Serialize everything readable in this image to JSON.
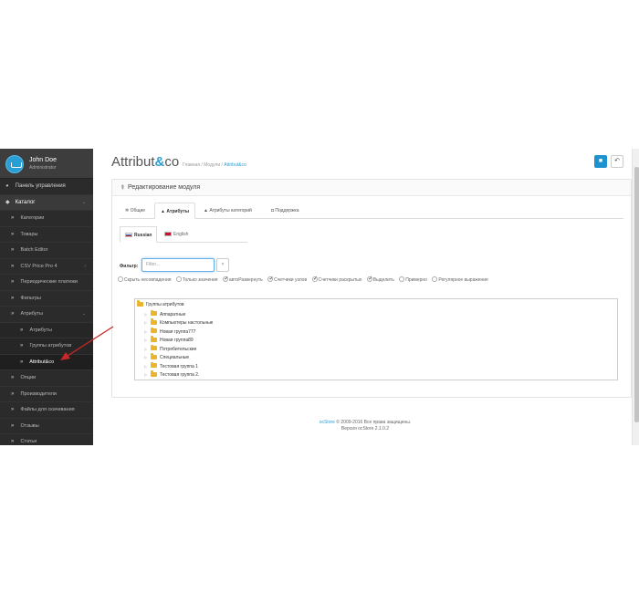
{
  "sidebar": {
    "user": {
      "name": "John Doe",
      "role": "Administrator"
    },
    "items": [
      {
        "label": "Панель управления",
        "icon": "dashboard-icon"
      },
      {
        "label": "Каталог",
        "icon": "tags-icon"
      },
      {
        "label": "Категории"
      },
      {
        "label": "Товары"
      },
      {
        "label": "Batch Editor"
      },
      {
        "label": "CSV Price Pro 4"
      },
      {
        "label": "Периодические платежи"
      },
      {
        "label": "Фильтры"
      },
      {
        "label": "Атрибуты"
      },
      {
        "label": "Атрибуты"
      },
      {
        "label": "Группы атрибутов"
      },
      {
        "label": "Attribut&co"
      },
      {
        "label": "Опции"
      },
      {
        "label": "Производители"
      },
      {
        "label": "Файлы для скачивания"
      },
      {
        "label": "Отзывы"
      },
      {
        "label": "Статьи"
      }
    ]
  },
  "header": {
    "title_main": "Attribut",
    "title_amp": "&",
    "title_tail": "co",
    "breadcrumb": [
      "Главная",
      "Модули",
      "Attribut&co"
    ]
  },
  "panel": {
    "heading": "Редактирование модуля",
    "tabs": [
      "Общие",
      "Атрибуты",
      "Атрибуты категорий",
      "Поддержка"
    ],
    "lang_tabs": [
      "Russian",
      "English"
    ],
    "filter_label": "Фильтр:",
    "filter_placeholder": "Filter...",
    "filter_clear": "×",
    "options": [
      {
        "label": "Скрыть несовпадения",
        "checked": false
      },
      {
        "label": "Только значения",
        "checked": false
      },
      {
        "label": "автоРазвернуть",
        "checked": true
      },
      {
        "label": "Счетчики узлов",
        "checked": true
      },
      {
        "label": "Счетчики раскрытых",
        "checked": true
      },
      {
        "label": "Выделить",
        "checked": true
      },
      {
        "label": "Примерно",
        "checked": false
      },
      {
        "label": "Регулярное выражение",
        "checked": false
      }
    ],
    "tree": {
      "root": "Группы атрибутов",
      "children": [
        "Аппаратные",
        "Компьютеры настольные",
        "Новая группа777",
        "Новая группа89",
        "Потребительские",
        "Специальные",
        "Тестовая группа 1",
        "Тестовая группа 2."
      ]
    }
  },
  "footer": {
    "brand": "ocStore",
    "copyright": " © 2009-2016 Все права защищены.",
    "version": "Версия ocStore 2.1.0.2"
  },
  "colors": {
    "accent": "#2a9fd6",
    "sidebar_bg": "#2b2b2b",
    "annotation_arrow": "#c62828"
  }
}
